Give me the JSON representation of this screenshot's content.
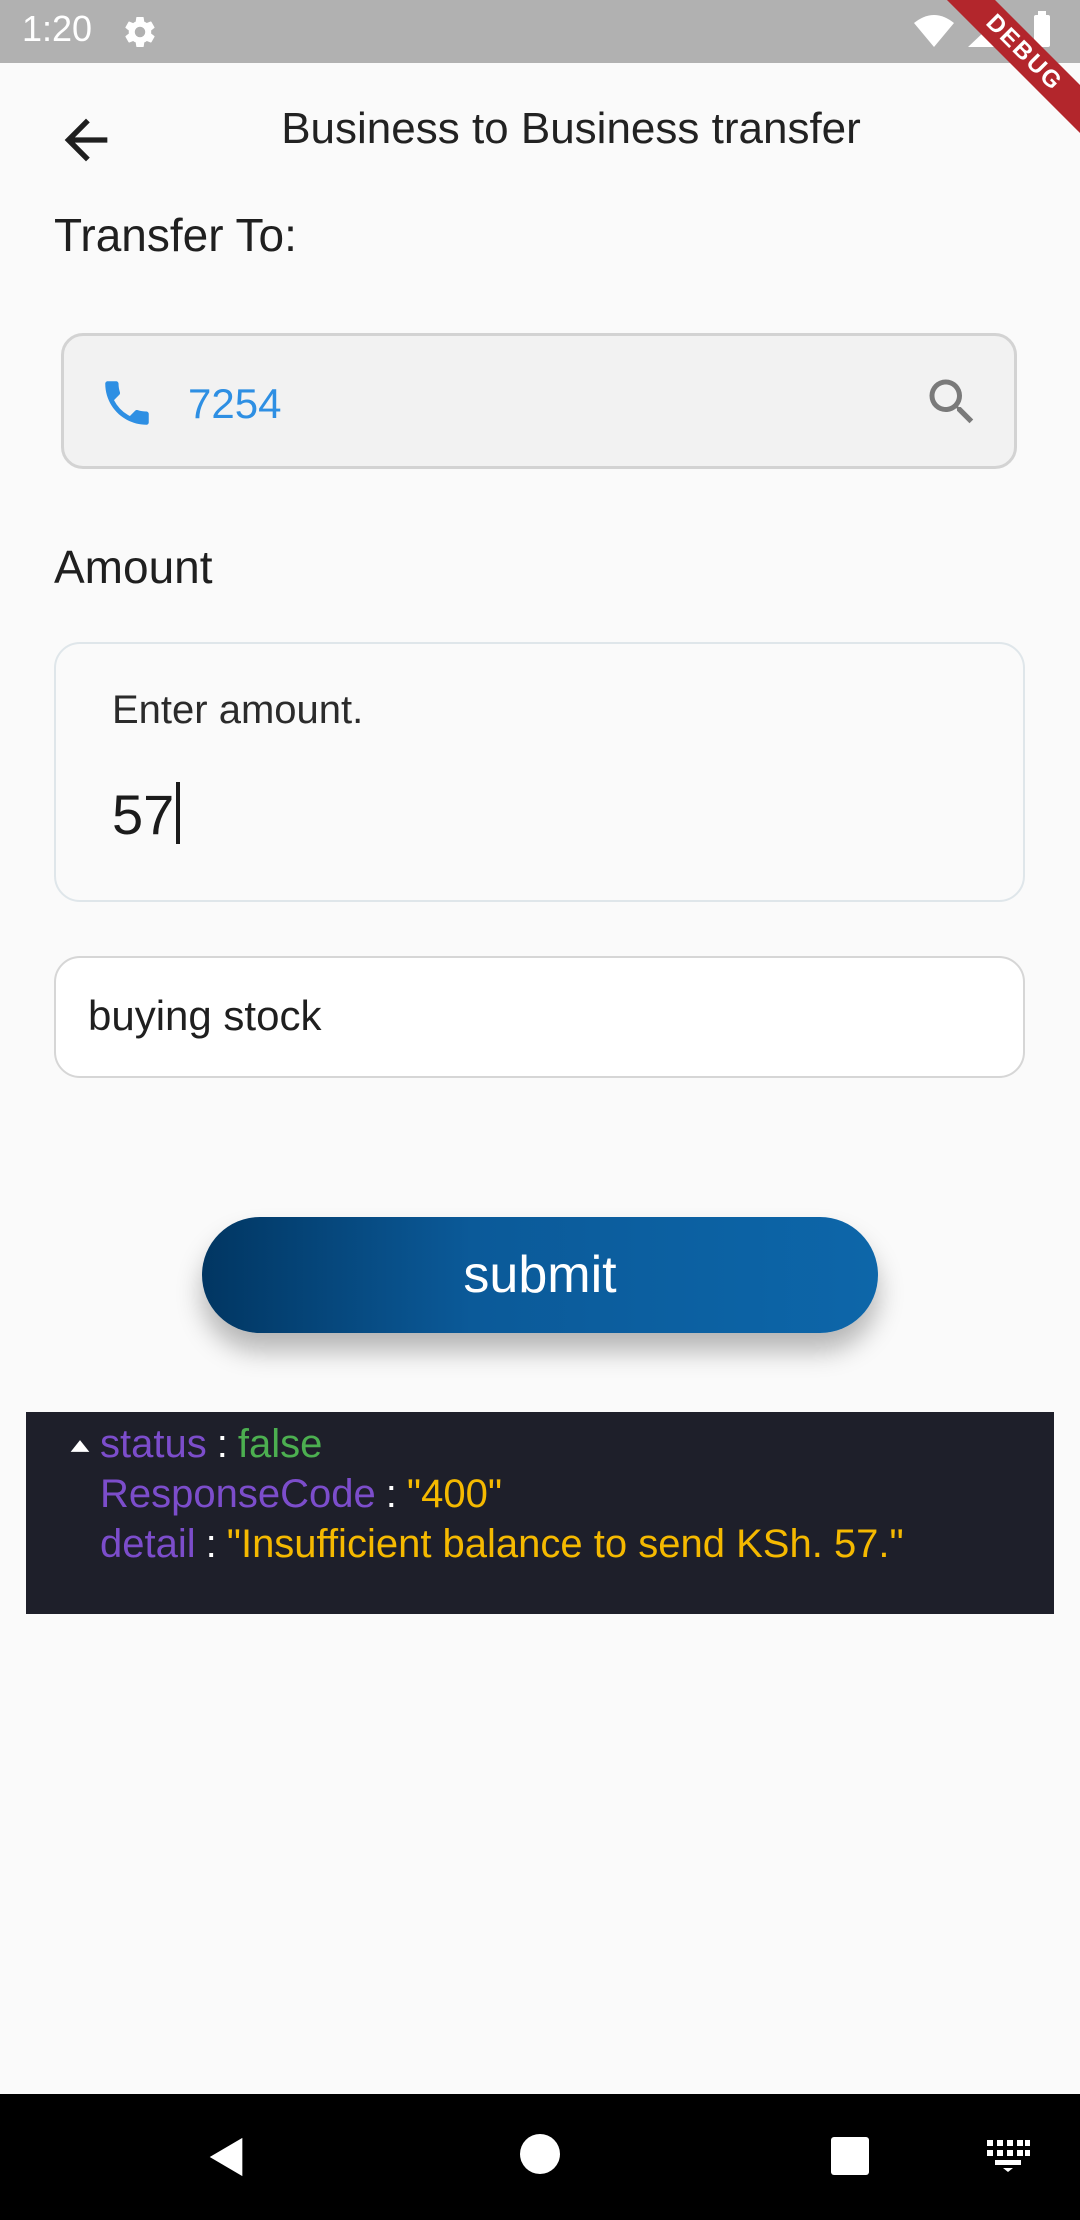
{
  "status_bar": {
    "time": "1:20",
    "debug_label": "DEBUG"
  },
  "app_bar": {
    "title": "Business to Business transfer"
  },
  "transfer_to": {
    "label": "Transfer To:",
    "phone_value": "7254"
  },
  "amount": {
    "label": "Amount",
    "hint": "Enter amount.",
    "value": "57"
  },
  "description": {
    "value": "buying stock"
  },
  "submit": {
    "label": "submit"
  },
  "response": {
    "rows": [
      {
        "key": "status",
        "value": "false"
      },
      {
        "key": "ResponseCode",
        "value": "\"400\""
      },
      {
        "key": "detail",
        "value": "\"Insufficient balance to send KSh. 57.\""
      }
    ]
  },
  "colors": {
    "accent_blue": "#2e8fe3",
    "submit_dark": "#013662",
    "submit_light": "#0d66a9",
    "json_key": "#7c4dcb",
    "json_bool": "#4caf50",
    "json_string": "#f5b900"
  },
  "icons": [
    "gear-icon",
    "wifi-icon",
    "signal-icon",
    "battery-icon",
    "back-arrow-icon",
    "phone-icon",
    "search-icon",
    "collapse-arrow-icon",
    "nav-back-icon",
    "nav-home-icon",
    "nav-recents-icon",
    "keyboard-icon"
  ]
}
